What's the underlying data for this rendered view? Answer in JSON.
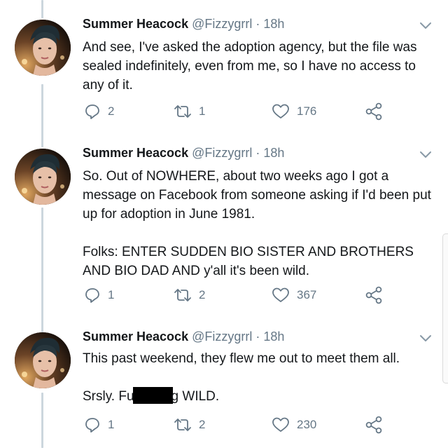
{
  "tweets": [
    {
      "author_name": "Summer Heacock",
      "handle": "@Fizzygrrl",
      "separator": "·",
      "time": "18h",
      "text_paragraphs": [
        "And see, I've asked the adoption agency, but the file was sealed indefinitely, even from me, so I have no access to any of it."
      ],
      "reply_count": "2",
      "retweet_count": "1",
      "like_count": "176"
    },
    {
      "author_name": "Summer Heacock",
      "handle": "@Fizzygrrl",
      "separator": "·",
      "time": "18h",
      "text_paragraphs": [
        "So. Out of NOWHERE, about two weeks ago I got a message on Facebook from someone asking if I'd been put up for adoption in June 1981.",
        "Folks: ENTER SUDDEN BIO SISTER AND BROTHERS AND BIO DAD AND y'all it's been wild."
      ],
      "reply_count": "1",
      "retweet_count": "2",
      "like_count": "367"
    },
    {
      "author_name": "Summer Heacock",
      "handle": "@Fizzygrrl",
      "separator": "·",
      "time": "18h",
      "text_paragraphs": [
        "This past weekend, they flew me out to meet them all."
      ],
      "last_paragraph_parts": [
        "Srsly. Fu",
        "g WILD."
      ],
      "reply_count": "1",
      "retweet_count": "2",
      "like_count": "230"
    }
  ],
  "icons": {
    "caret": "chevron-down-icon",
    "reply": "reply-icon",
    "retweet": "retweet-icon",
    "like": "heart-icon",
    "share": "share-icon"
  },
  "colors": {
    "text": "#14171a",
    "muted": "#657786",
    "thread_line": "#ccd6dd",
    "redaction": "#000000"
  }
}
